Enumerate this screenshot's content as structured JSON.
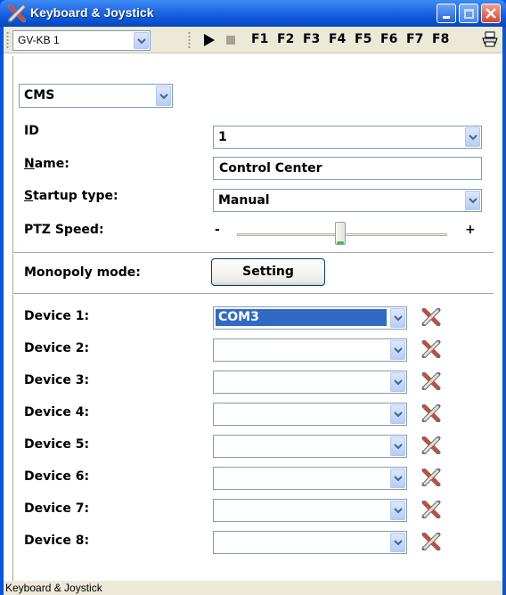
{
  "window": {
    "title": "Keyboard & Joystick"
  },
  "toolbar": {
    "keyboard_select": "GV-KB 1",
    "function_keys": [
      "F1",
      "F2",
      "F3",
      "F4",
      "F5",
      "F6",
      "F7",
      "F8"
    ],
    "play_icon": "play-icon",
    "stop_icon": "stop-icon",
    "print_icon": "printer-icon"
  },
  "form": {
    "mode_select": "CMS",
    "id": {
      "label": "ID",
      "value": "1"
    },
    "name": {
      "label": "Name:",
      "value": "Control Center"
    },
    "startup_type": {
      "label": "Startup type:",
      "value": "Manual"
    },
    "ptz_speed": {
      "label": "PTZ Speed:",
      "min_label": "-",
      "max_label": "+",
      "level": 0.5
    },
    "monopoly_mode": {
      "label": "Monopoly mode:",
      "button": "Setting"
    }
  },
  "devices": [
    {
      "label": "Device 1:",
      "value": "COM3"
    },
    {
      "label": "Device 2:",
      "value": ""
    },
    {
      "label": "Device 3:",
      "value": ""
    },
    {
      "label": "Device 4:",
      "value": ""
    },
    {
      "label": "Device 5:",
      "value": ""
    },
    {
      "label": "Device 6:",
      "value": ""
    },
    {
      "label": "Device 7:",
      "value": ""
    },
    {
      "label": "Device 8:",
      "value": ""
    }
  ],
  "status": {
    "text": "Keyboard & Joystick"
  },
  "colors": {
    "titlebar": "#0a55d8",
    "selection": "#316ac5",
    "face": "#ece9d8"
  }
}
